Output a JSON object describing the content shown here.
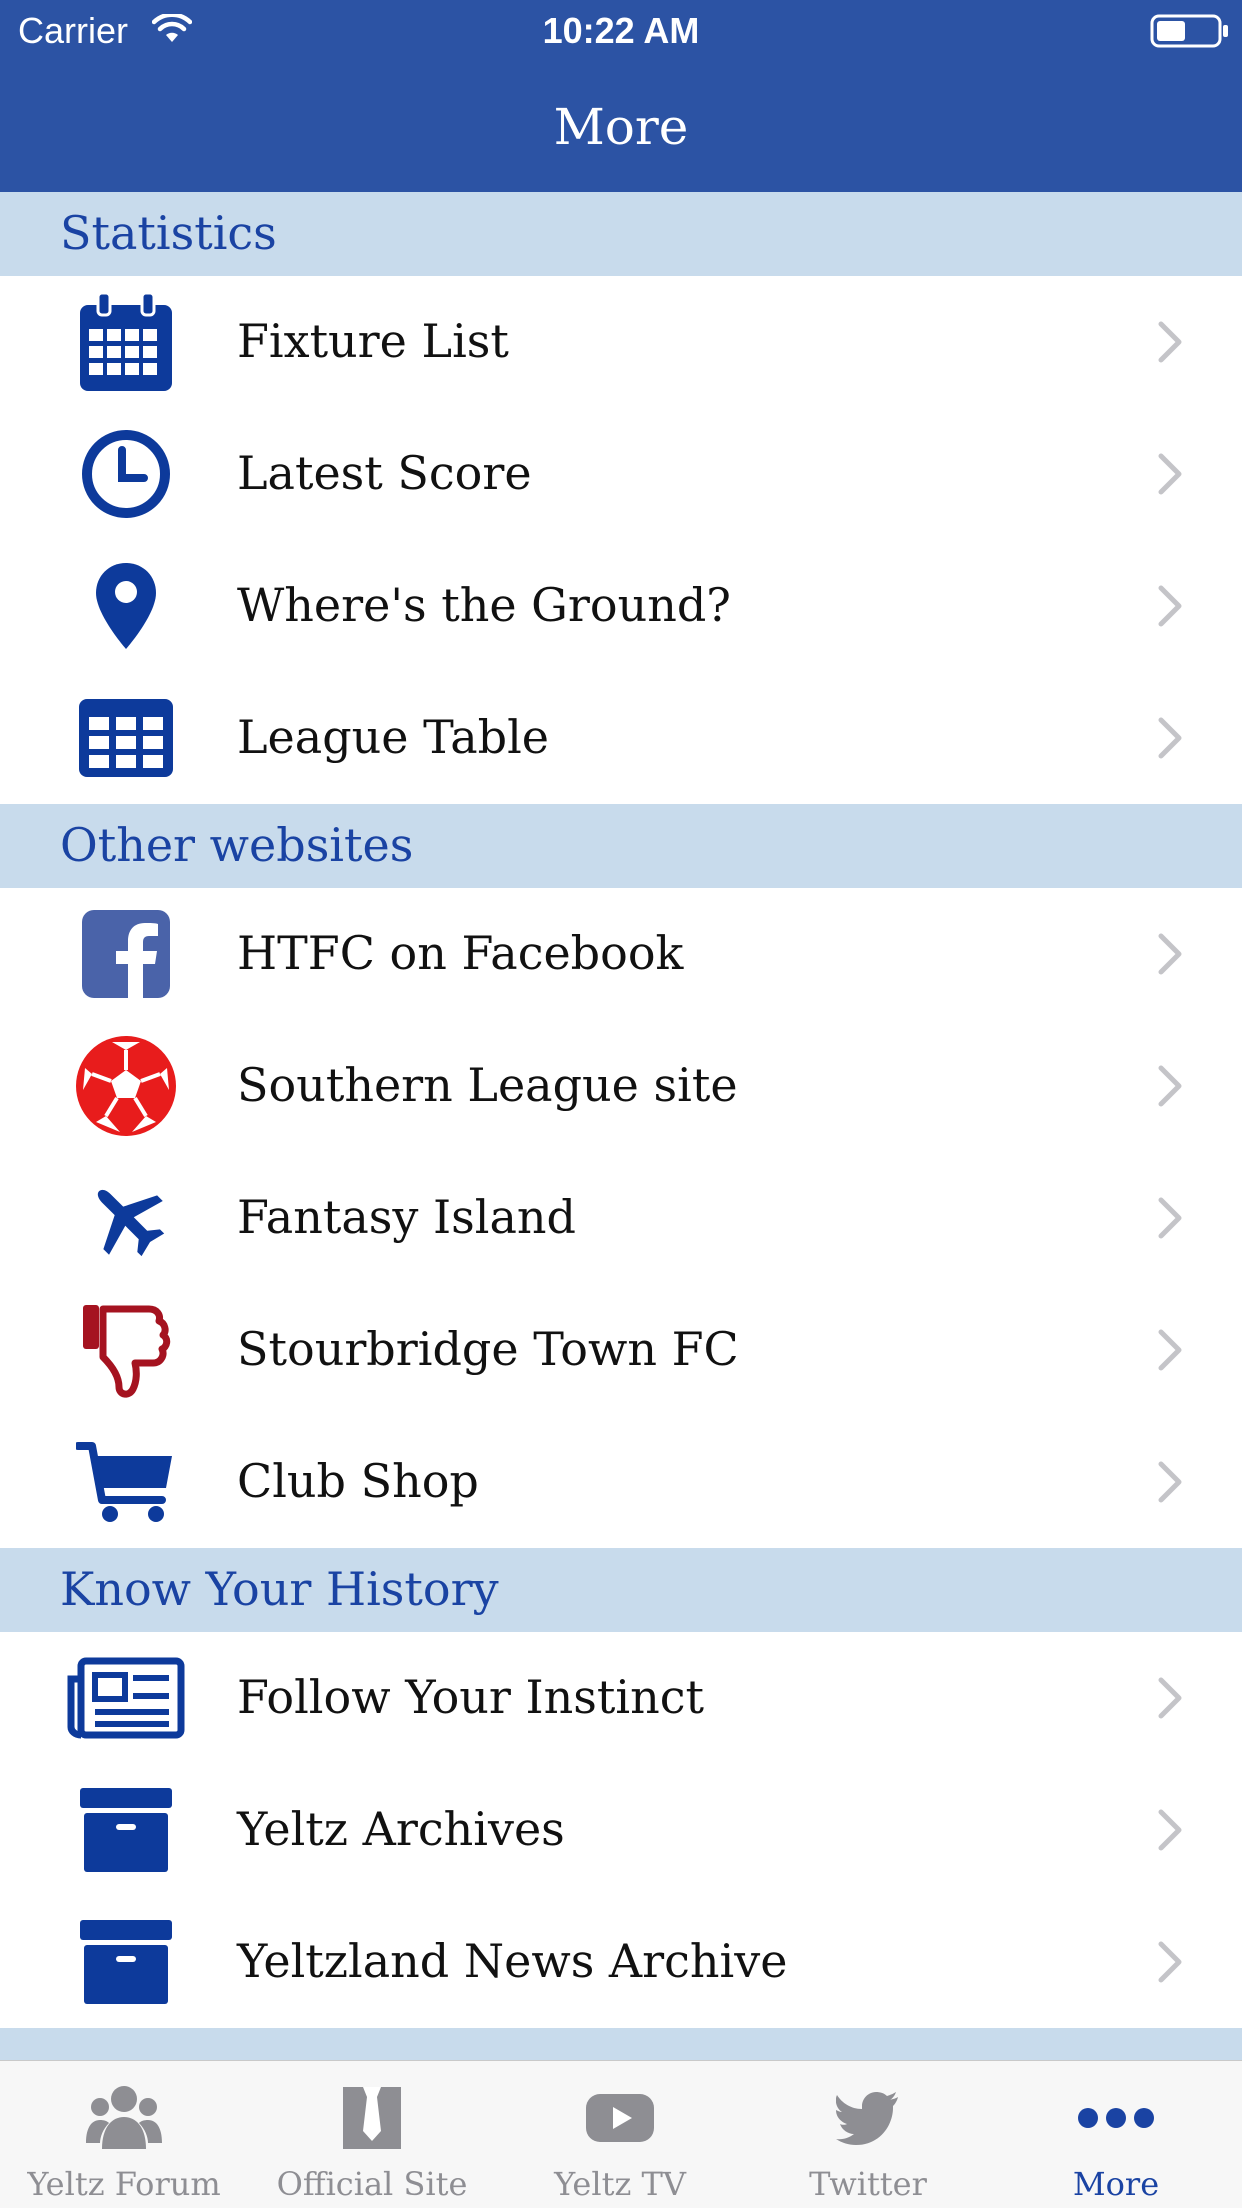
{
  "status_bar": {
    "carrier": "Carrier",
    "time": "10:22 AM"
  },
  "nav": {
    "title": "More"
  },
  "sections": [
    {
      "title": "Statistics",
      "items": [
        {
          "label": "Fixture List",
          "icon": "calendar-icon"
        },
        {
          "label": "Latest Score",
          "icon": "clock-icon"
        },
        {
          "label": "Where's the Ground?",
          "icon": "map-pin-icon"
        },
        {
          "label": "League Table",
          "icon": "table-icon"
        }
      ]
    },
    {
      "title": "Other websites",
      "items": [
        {
          "label": "HTFC on Facebook",
          "icon": "facebook-icon"
        },
        {
          "label": "Southern League site",
          "icon": "football-icon"
        },
        {
          "label": "Fantasy Island",
          "icon": "airplane-icon"
        },
        {
          "label": "Stourbridge Town FC",
          "icon": "thumbs-down-icon"
        },
        {
          "label": "Club Shop",
          "icon": "cart-icon"
        }
      ]
    },
    {
      "title": "Know Your History",
      "items": [
        {
          "label": "Follow Your Instinct",
          "icon": "newspaper-icon"
        },
        {
          "label": "Yeltz Archives",
          "icon": "archive-box-icon"
        },
        {
          "label": "Yeltzland News Archive",
          "icon": "archive-box-icon"
        }
      ]
    }
  ],
  "tabs": [
    {
      "label": "Yeltz Forum",
      "icon": "group-icon"
    },
    {
      "label": "Official Site",
      "icon": "shirt-icon"
    },
    {
      "label": "Yeltz TV",
      "icon": "youtube-icon"
    },
    {
      "label": "Twitter",
      "icon": "twitter-icon"
    },
    {
      "label": "More",
      "icon": "more-icon"
    }
  ],
  "colors": {
    "header": "#2c53a4",
    "section_bg": "#c8dbec",
    "accent": "#1a43a3",
    "icon_blue": "#0d3a9b",
    "facebook": "#4a63a9",
    "football": "#e81c1c",
    "thumbs_down": "#a51320",
    "tab_inactive": "#8e8e93"
  }
}
